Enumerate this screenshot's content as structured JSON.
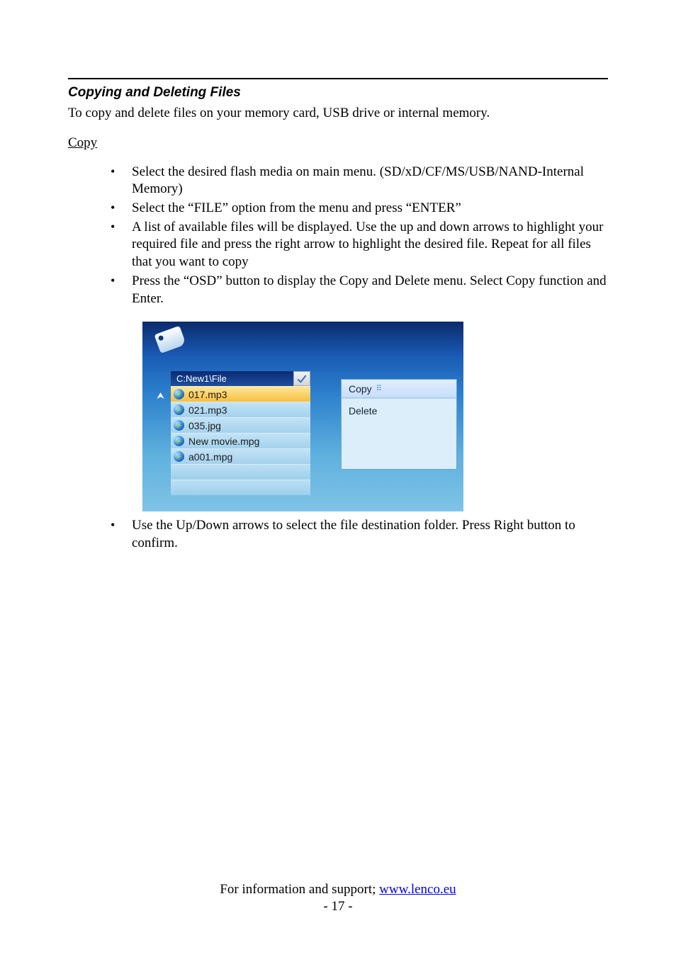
{
  "heading": "Copying and Deleting Files",
  "intro": "To copy and delete files on your memory card, USB drive or internal memory.",
  "subhead": "Copy",
  "bullets": [
    "Select the desired flash media on main menu. (SD/xD/CF/MS/USB/NAND-Internal Memory)",
    "Select the “FILE” option from the menu and press “ENTER”",
    "A list of available files will be displayed. Use the up and down arrows to highlight your required file and press the right arrow to highlight the desired file. Repeat for all files that you want to copy",
    "Press the “OSD” button to display the Copy and Delete menu. Select Copy function and Enter."
  ],
  "ui": {
    "path": "C:New1\\File",
    "files": [
      "017.mp3",
      "021.mp3",
      "035.jpg",
      "New movie.mpg",
      "a001.mpg"
    ],
    "menu": {
      "copy": "Copy",
      "delete": "Delete"
    }
  },
  "below_bullet": "Use the Up/Down arrows to select the file destination folder. Press Right button to confirm.",
  "footer": {
    "prefix": "For information and support; ",
    "link": "www.lenco.eu",
    "pagenum": "- 17 -"
  }
}
